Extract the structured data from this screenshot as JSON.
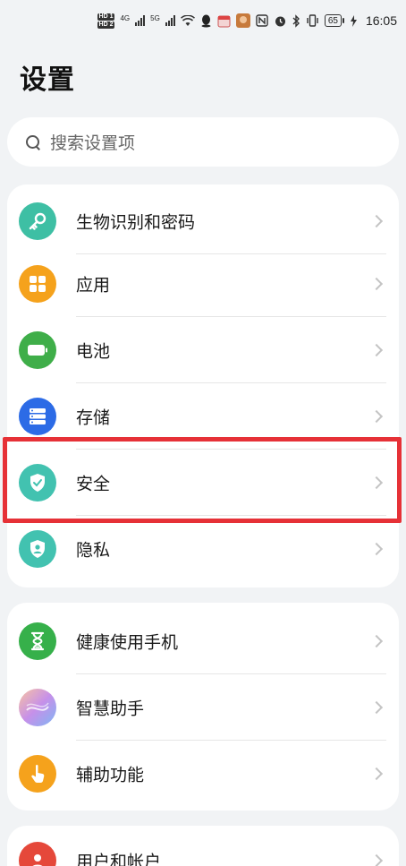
{
  "status_bar": {
    "hd1": "HD 1",
    "hd2": "HD 2",
    "net1": "4G",
    "net2": "5G",
    "battery": "65",
    "time": "16:05"
  },
  "title": "设置",
  "search": {
    "placeholder": "搜索设置项"
  },
  "groups": [
    {
      "items": [
        {
          "label": "生物识别和密码",
          "icon": "key-icon",
          "color": "#3ebfa4"
        },
        {
          "label": "应用",
          "icon": "apps-icon",
          "color": "#f5a21c"
        },
        {
          "label": "电池",
          "icon": "battery-icon",
          "color": "#3fae49"
        },
        {
          "label": "存储",
          "icon": "storage-icon",
          "color": "#2c6be6"
        },
        {
          "label": "安全",
          "icon": "shield-icon",
          "color": "#42c2b0"
        },
        {
          "label": "隐私",
          "icon": "privacy-icon",
          "color": "#42c2b0"
        }
      ]
    },
    {
      "items": [
        {
          "label": "健康使用手机",
          "icon": "hourglass-icon",
          "color": "#36b04a"
        },
        {
          "label": "智慧助手",
          "icon": "assistant-icon",
          "color": "#b88ee8"
        },
        {
          "label": "辅助功能",
          "icon": "hand-icon",
          "color": "#f5a21c"
        }
      ]
    },
    {
      "items": [
        {
          "label": "用户和帐户",
          "icon": "user-icon",
          "color": "#e5483a"
        }
      ]
    }
  ],
  "highlight_color": "#e63137"
}
